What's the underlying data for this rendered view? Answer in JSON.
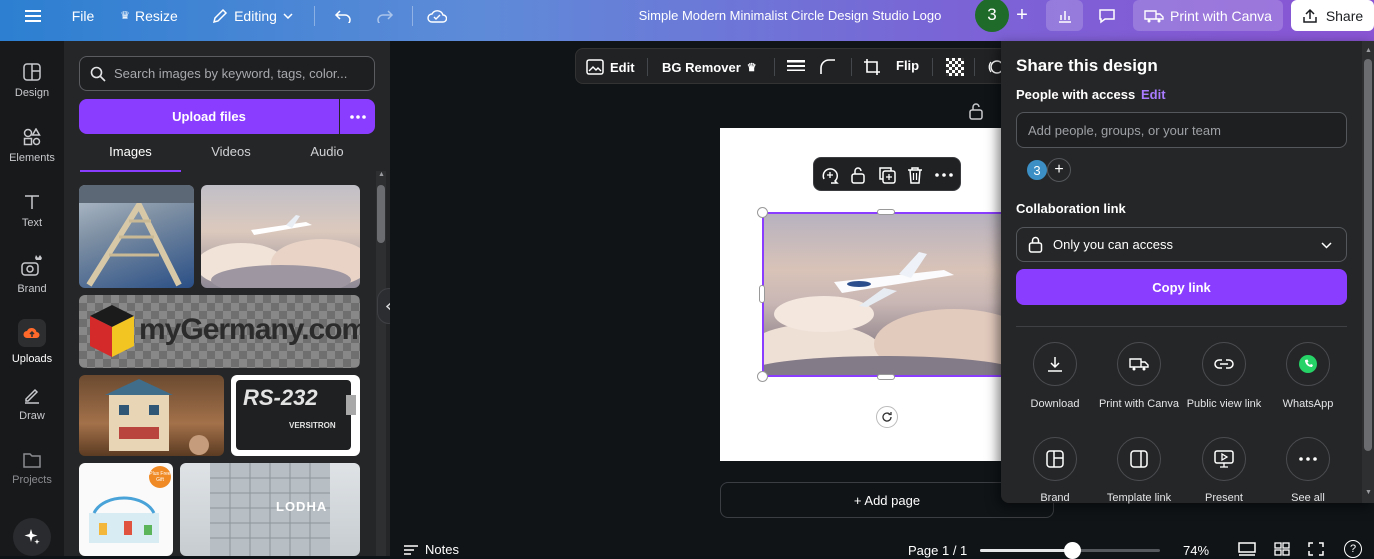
{
  "topbar": {
    "file": "File",
    "resize": "Resize",
    "mode": "Editing",
    "title": "Simple Modern Minimalist Circle Design Studio Logo",
    "avatar": "3",
    "print": "Print with Canva",
    "share": "Share"
  },
  "rail": {
    "items": [
      {
        "label": "Design",
        "icon": "design-icon"
      },
      {
        "label": "Elements",
        "icon": "elements-icon"
      },
      {
        "label": "Text",
        "icon": "text-icon"
      },
      {
        "label": "Brand",
        "icon": "brand-icon"
      },
      {
        "label": "Uploads",
        "icon": "uploads-icon"
      },
      {
        "label": "Draw",
        "icon": "draw-icon"
      },
      {
        "label": "Projects",
        "icon": "projects-icon"
      }
    ]
  },
  "panel": {
    "search_placeholder": "Search images by keyword, tags, color...",
    "upload": "Upload files",
    "tabs": [
      "Images",
      "Videos",
      "Audio"
    ],
    "thumb_texts": {
      "germany": "myGermany.com",
      "rs232": "RS-232",
      "versitron": "VERSITRON",
      "lodha": "LODHA",
      "plus": "Plus Free Gift"
    }
  },
  "ctxbar": {
    "edit": "Edit",
    "bg_remover": "BG Remover",
    "flip": "Flip"
  },
  "canvas": {
    "add_page": "+ Add page"
  },
  "share": {
    "title": "Share this design",
    "people_label": "People with access",
    "edit_link": "Edit",
    "input_placeholder": "Add people, groups, or your team",
    "avatar": "3",
    "collab_label": "Collaboration link",
    "access": "Only you can access",
    "copy": "Copy link",
    "options": [
      {
        "label": "Download",
        "icon": "download-icon"
      },
      {
        "label": "Print with Canva",
        "icon": "truck-icon"
      },
      {
        "label": "Public view link",
        "icon": "link-icon"
      },
      {
        "label": "WhatsApp",
        "icon": "whatsapp-icon"
      },
      {
        "label": "Brand",
        "icon": "brand-template-icon"
      },
      {
        "label": "Template link",
        "icon": "template-link-icon"
      },
      {
        "label": "Present",
        "icon": "present-icon"
      },
      {
        "label": "See all",
        "icon": "more-icon"
      }
    ]
  },
  "bottom": {
    "notes": "Notes",
    "page": "Page 1 / 1",
    "zoom": "74%",
    "zoom_level": 0.51
  },
  "colors": {
    "accent": "#8b3dff",
    "avatar_green": "#1f6b2a",
    "avatar_blue": "#3b8fc4"
  }
}
